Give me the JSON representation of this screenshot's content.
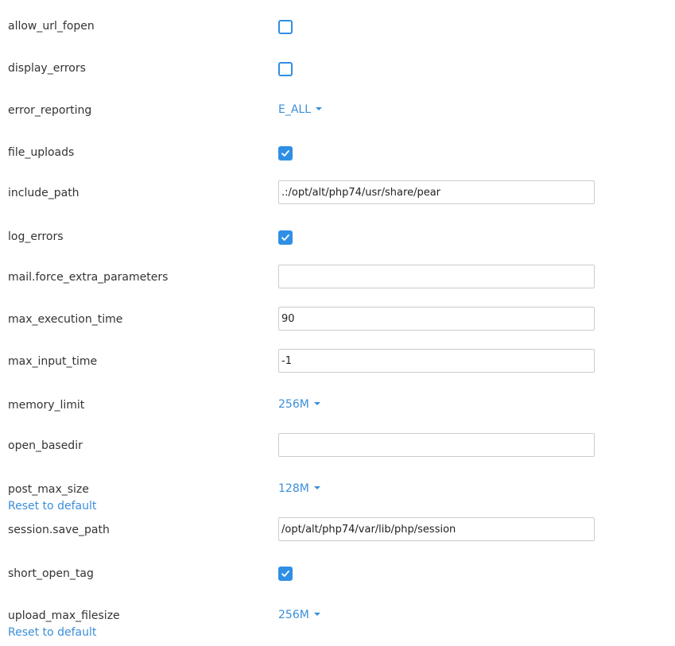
{
  "settings": {
    "allow_url_fopen": {
      "label": "allow_url_fopen",
      "type": "checkbox",
      "checked": false
    },
    "display_errors": {
      "label": "display_errors",
      "type": "checkbox",
      "checked": false
    },
    "error_reporting": {
      "label": "error_reporting",
      "type": "dropdown",
      "value": "E_ALL"
    },
    "file_uploads": {
      "label": "file_uploads",
      "type": "checkbox",
      "checked": true
    },
    "include_path": {
      "label": "include_path",
      "type": "text",
      "value": ".:/opt/alt/php74/usr/share/pear"
    },
    "log_errors": {
      "label": "log_errors",
      "type": "checkbox",
      "checked": true
    },
    "mail_force_extra_parameters": {
      "label": "mail.force_extra_parameters",
      "type": "text",
      "value": ""
    },
    "max_execution_time": {
      "label": "max_execution_time",
      "type": "text",
      "value": "90"
    },
    "max_input_time": {
      "label": "max_input_time",
      "type": "text",
      "value": "-1"
    },
    "memory_limit": {
      "label": "memory_limit",
      "type": "dropdown",
      "value": "256M"
    },
    "open_basedir": {
      "label": "open_basedir",
      "type": "text",
      "value": ""
    },
    "post_max_size": {
      "label": "post_max_size",
      "type": "dropdown",
      "value": "128M",
      "reset_label": "Reset to default"
    },
    "session_save_path": {
      "label": "session.save_path",
      "type": "text",
      "value": "/opt/alt/php74/var/lib/php/session"
    },
    "short_open_tag": {
      "label": "short_open_tag",
      "type": "checkbox",
      "checked": true
    },
    "upload_max_filesize": {
      "label": "upload_max_filesize",
      "type": "dropdown",
      "value": "256M",
      "reset_label": "Reset to default"
    }
  },
  "colors": {
    "accent": "#2f8fe5",
    "link": "#3a8fd8",
    "text": "#333333",
    "input_border": "#c9ccd1"
  },
  "icons": {
    "checkmark": "check-icon",
    "dropdown": "caret-down-icon"
  }
}
